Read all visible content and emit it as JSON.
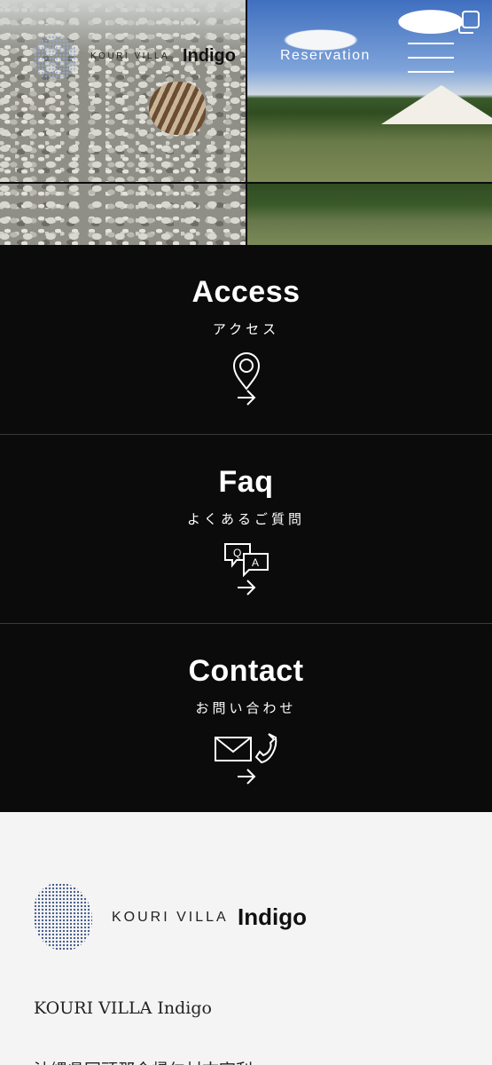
{
  "header": {
    "brand_small": "KOURI VILLA",
    "brand_bold": "Indigo",
    "reservation_label": "Reservation",
    "menu_icon": "hamburger-menu-icon",
    "copy_icon": "copy-icon"
  },
  "sections": [
    {
      "title": "Access",
      "subtitle": "アクセス",
      "icon": "map-pin-icon",
      "arrow_icon": "arrow-right-icon"
    },
    {
      "title": "Faq",
      "subtitle": "よくあるご質問",
      "icon": "qa-bubbles-icon",
      "arrow_icon": "arrow-right-icon"
    },
    {
      "title": "Contact",
      "subtitle": "お問い合わせ",
      "icon": "mail-phone-icon",
      "arrow_icon": "arrow-right-icon"
    }
  ],
  "footer": {
    "brand_small": "KOURI VILLA",
    "brand_bold": "Indigo",
    "name": "KOURI VILLA Indigo",
    "address": "沖縄県国頭郡今帰仁村古宇利"
  },
  "colors": {
    "section_bg": "#0b0b0b",
    "footer_bg": "#f4f4f4",
    "divider": "#3a3a3a",
    "logo_dots": "#4a5f8f"
  }
}
